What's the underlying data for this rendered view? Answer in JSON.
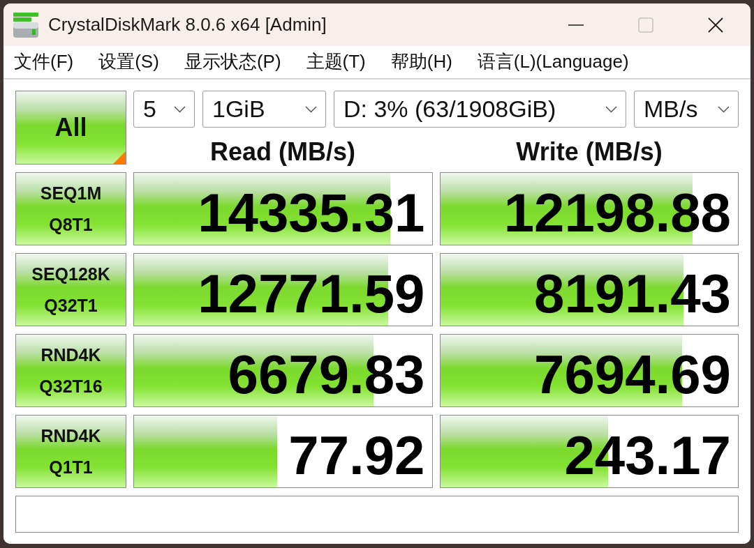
{
  "window": {
    "title": "CrystalDiskMark 8.0.6 x64 [Admin]",
    "controls": [
      {
        "kind": "minimize",
        "disabled": false
      },
      {
        "kind": "maximize",
        "disabled": true
      },
      {
        "kind": "close",
        "disabled": false
      }
    ]
  },
  "menu": [
    {
      "label": "文件(F)"
    },
    {
      "label": "设置(S)"
    },
    {
      "label": "显示状态(P)"
    },
    {
      "label": "主题(T)"
    },
    {
      "label": "帮助(H)"
    },
    {
      "label": "语言(L)(Language)"
    }
  ],
  "all_button": {
    "label": "All"
  },
  "selectors": [
    {
      "value": "5"
    },
    {
      "value": "1GiB"
    },
    {
      "value": "D: 3% (63/1908GiB)"
    },
    {
      "value": "MB/s"
    }
  ],
  "columns": [
    {
      "label": "Read (MB/s)"
    },
    {
      "label": "Write (MB/s)"
    }
  ],
  "tests": [
    {
      "name": "SEQ1M",
      "params": "Q8T1",
      "read": {
        "reading": "14335.31",
        "level": 0.86
      },
      "write": {
        "reading": "12198.88",
        "level": 0.848
      }
    },
    {
      "name": "SEQ128K",
      "params": "Q32T1",
      "read": {
        "reading": "12771.59",
        "level": 0.853
      },
      "write": {
        "reading": "8191.43",
        "level": 0.818
      }
    },
    {
      "name": "RND4K",
      "params": "Q32T16",
      "read": {
        "reading": "6679.83",
        "level": 0.804
      },
      "write": {
        "reading": "7694.69",
        "level": 0.813
      }
    },
    {
      "name": "RND4K",
      "params": "Q1T1",
      "read": {
        "reading": "77.92",
        "level": 0.481
      },
      "write": {
        "reading": "243.17",
        "level": 0.563
      }
    }
  ]
}
